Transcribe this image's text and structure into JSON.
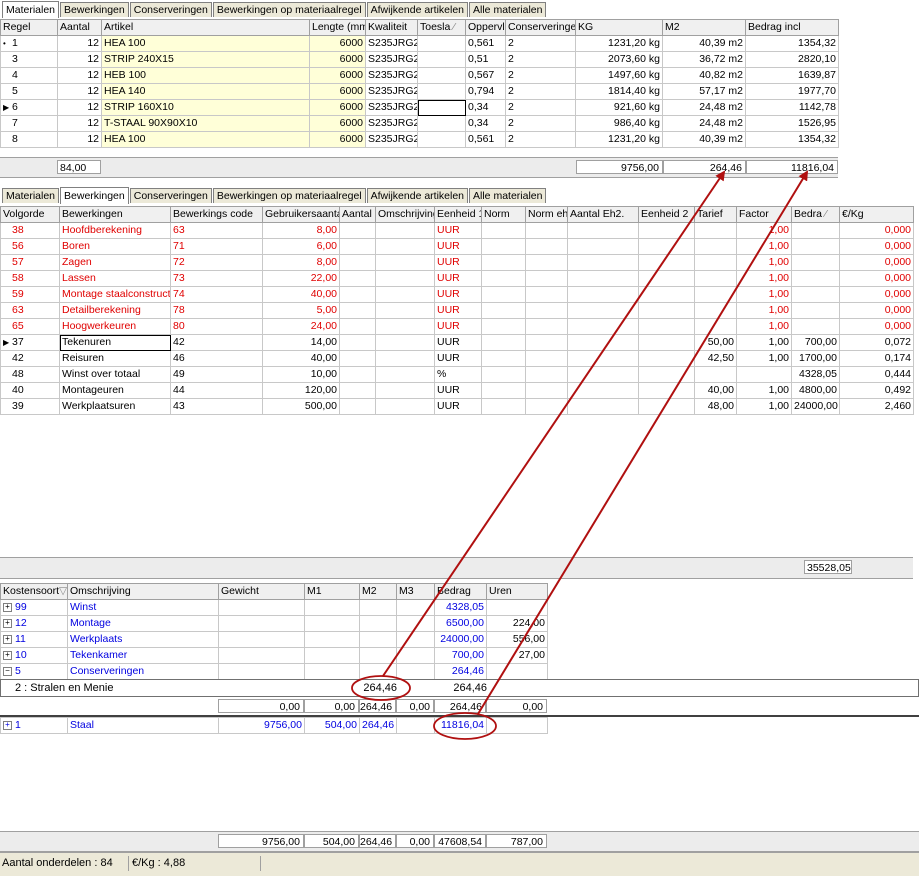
{
  "top_tabs": [
    "Materialen",
    "Bewerkingen",
    "Conserveringen",
    "Bewerkingen op materiaalregel",
    "Afwijkende artikelen",
    "Alle materialen"
  ],
  "materials": {
    "columns": [
      "Regel",
      "Aantal",
      "Artikel",
      "Lengte (mm)",
      "Kwaliteit",
      "Toesla",
      "Oppervl",
      "Conserveringen",
      "KG",
      "M2",
      "Bedrag incl"
    ],
    "rows": [
      [
        "1",
        "12",
        "HEA  100",
        "6000",
        "S235JRG2",
        "",
        "0,561",
        "2",
        "1231,20 kg",
        "40,39 m2",
        "1354,32"
      ],
      [
        "3",
        "12",
        "STRIP 240X15",
        "6000",
        "S235JRG2",
        "",
        "0,51",
        "2",
        "2073,60 kg",
        "36,72 m2",
        "2820,10"
      ],
      [
        "4",
        "12",
        "HEB  100",
        "6000",
        "S235JRG2",
        "",
        "0,567",
        "2",
        "1497,60 kg",
        "40,82 m2",
        "1639,87"
      ],
      [
        "5",
        "12",
        "HEA  140",
        "6000",
        "S235JRG2",
        "",
        "0,794",
        "2",
        "1814,40 kg",
        "57,17 m2",
        "1977,70"
      ],
      [
        "6",
        "12",
        "STRIP 160X10",
        "6000",
        "S235JRG2",
        "",
        "0,34",
        "2",
        "921,60 kg",
        "24,48 m2",
        "1142,78"
      ],
      [
        "7",
        "12",
        "T-STAAL 90X90X10",
        "6000",
        "S235JRG2",
        "",
        "0,34",
        "2",
        "986,40 kg",
        "24,48 m2",
        "1526,95"
      ],
      [
        "8",
        "12",
        "HEA  100",
        "6000",
        "S235JRG2",
        "",
        "0,561",
        "2",
        "1231,20 kg",
        "40,39 m2",
        "1354,32"
      ]
    ],
    "totals": {
      "aantal": "84,00",
      "kg": "9756,00",
      "m2": "264,46",
      "bedrag": "11816,04"
    }
  },
  "mid_tabs": [
    "Materialen",
    "Bewerkingen",
    "Conserveringen",
    "Bewerkingen op materiaalregel",
    "Afwijkende artikelen",
    "Alle materialen"
  ],
  "operations": {
    "columns": [
      "Volgorde",
      "Bewerkingen",
      "Bewerkings code",
      "Gebruikersaantal",
      "Aantal",
      "Omschrijving",
      "Eenheid 1",
      "Norm",
      "Norm eh.",
      "Aantal Eh2.",
      "Eenheid 2",
      "Tarief",
      "Factor",
      "Bedra",
      "€/Kg"
    ],
    "rows": [
      {
        "c": [
          "38",
          "Hoofdberekening",
          "63",
          "8,00",
          "",
          "",
          "UUR",
          "",
          "",
          "",
          "",
          "",
          "1,00",
          "",
          "0,000"
        ],
        "red": true
      },
      {
        "c": [
          "56",
          "Boren",
          "71",
          "6,00",
          "",
          "",
          "UUR",
          "",
          "",
          "",
          "",
          "",
          "1,00",
          "",
          "0,000"
        ],
        "red": true
      },
      {
        "c": [
          "57",
          "Zagen",
          "72",
          "8,00",
          "",
          "",
          "UUR",
          "",
          "",
          "",
          "",
          "",
          "1,00",
          "",
          "0,000"
        ],
        "red": true
      },
      {
        "c": [
          "58",
          "Lassen",
          "73",
          "22,00",
          "",
          "",
          "UUR",
          "",
          "",
          "",
          "",
          "",
          "1,00",
          "",
          "0,000"
        ],
        "red": true
      },
      {
        "c": [
          "59",
          "Montage staalconstructie",
          "74",
          "40,00",
          "",
          "",
          "UUR",
          "",
          "",
          "",
          "",
          "",
          "1,00",
          "",
          "0,000"
        ],
        "red": true
      },
      {
        "c": [
          "63",
          "Detailberekening",
          "78",
          "5,00",
          "",
          "",
          "UUR",
          "",
          "",
          "",
          "",
          "",
          "1,00",
          "",
          "0,000"
        ],
        "red": true
      },
      {
        "c": [
          "65",
          "Hoogwerkeuren",
          "80",
          "24,00",
          "",
          "",
          "UUR",
          "",
          "",
          "",
          "",
          "",
          "1,00",
          "",
          "0,000"
        ],
        "red": true
      },
      {
        "c": [
          "37",
          "Tekenuren",
          "42",
          "14,00",
          "",
          "",
          "UUR",
          "",
          "",
          "",
          "",
          "50,00",
          "1,00",
          "700,00",
          "0,072"
        ],
        "red": false
      },
      {
        "c": [
          "42",
          "Reisuren",
          "46",
          "40,00",
          "",
          "",
          "UUR",
          "",
          "",
          "",
          "",
          "42,50",
          "1,00",
          "1700,00",
          "0,174"
        ],
        "red": false
      },
      {
        "c": [
          "48",
          "Winst over totaal",
          "49",
          "10,00",
          "",
          "",
          "%",
          "",
          "",
          "",
          "",
          "",
          "",
          "4328,05",
          "0,444"
        ],
        "red": false
      },
      {
        "c": [
          "40",
          "Montageuren",
          "44",
          "120,00",
          "",
          "",
          "UUR",
          "",
          "",
          "",
          "",
          "40,00",
          "1,00",
          "4800,00",
          "0,492"
        ],
        "red": false
      },
      {
        "c": [
          "39",
          "Werkplaatsuren",
          "43",
          "500,00",
          "",
          "",
          "UUR",
          "",
          "",
          "",
          "",
          "48,00",
          "1,00",
          "24000,00",
          "2,460"
        ],
        "red": false
      }
    ],
    "total": "35528,05"
  },
  "costs": {
    "columns": [
      "Kostensoort",
      "Omschrijving",
      "Gewicht",
      "M1",
      "M2",
      "M3",
      "Bedrag",
      "Uren"
    ],
    "groups": [
      {
        "code": "99",
        "name": "Winst",
        "gewicht": "",
        "m1": "",
        "m2": "",
        "m3": "",
        "bedrag": "4328,05",
        "uren": ""
      },
      {
        "code": "12",
        "name": "Montage",
        "gewicht": "",
        "m1": "",
        "m2": "",
        "m3": "",
        "bedrag": "6500,00",
        "uren": "224,00"
      },
      {
        "code": "11",
        "name": "Werkplaats",
        "gewicht": "",
        "m1": "",
        "m2": "",
        "m3": "",
        "bedrag": "24000,00",
        "uren": "556,00"
      },
      {
        "code": "10",
        "name": "Tekenkamer",
        "gewicht": "",
        "m1": "",
        "m2": "",
        "m3": "",
        "bedrag": "700,00",
        "uren": "27,00"
      },
      {
        "code": "5",
        "name": "Conserveringen",
        "gewicht": "",
        "m1": "",
        "m2": "",
        "m3": "",
        "bedrag": "264,46",
        "uren": ""
      }
    ],
    "sub_row": {
      "name": "2 : Stralen en Menie",
      "m2": "264,46",
      "bedrag": "264,46"
    },
    "sub_total": {
      "gewicht": "0,00",
      "m1": "0,00",
      "m2": "264,46",
      "m3": "0,00",
      "bedrag": "264,46",
      "uren": "0,00"
    },
    "staal": {
      "code": "1",
      "name": "Staal",
      "gewicht": "9756,00",
      "m1": "504,00",
      "m2": "264,46",
      "m3": "",
      "bedrag": "11816,04",
      "uren": ""
    },
    "grand_total": {
      "gewicht": "9756,00",
      "m1": "504,00",
      "m2": "264,46",
      "m3": "0,00",
      "bedrag": "47608,54",
      "uren": "787,00"
    }
  },
  "status": {
    "onderdelen": "Aantal onderdelen : 84",
    "eurokg": "€/Kg : 4,88"
  },
  "colors": {
    "red": "#e00000",
    "blue": "#0000e0",
    "annotation": "#b01010",
    "highlight": "#ffffd8"
  }
}
